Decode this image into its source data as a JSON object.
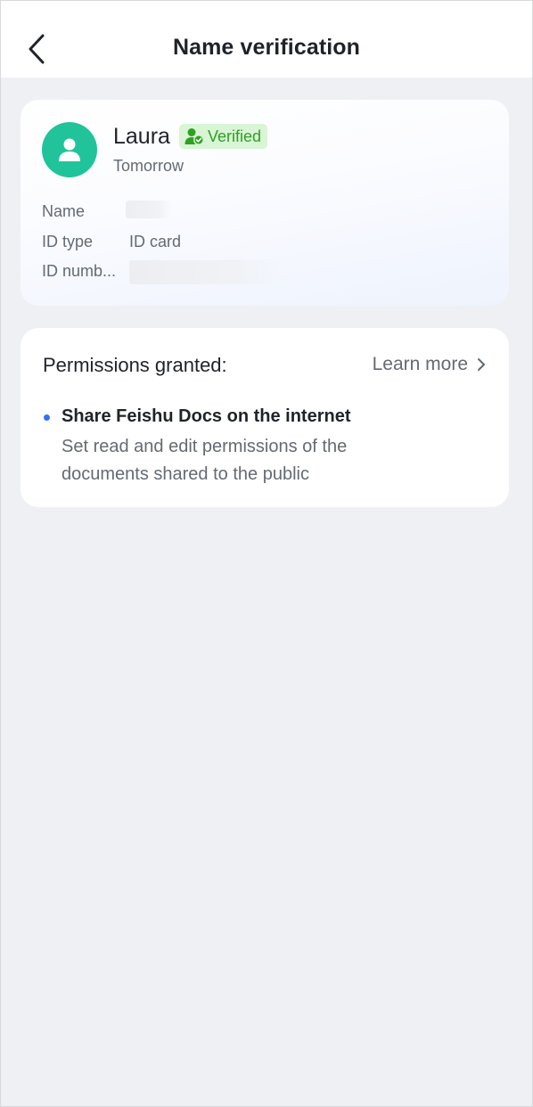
{
  "header": {
    "title": "Name verification"
  },
  "identity": {
    "name": "Laura",
    "badge": "Verified",
    "subtitle": "Tomorrow",
    "rows": [
      {
        "label": "Name",
        "value": ""
      },
      {
        "label": "ID type",
        "value": "ID card"
      },
      {
        "label": "ID numb...",
        "value": ""
      }
    ],
    "avatar_color": "#21c39a",
    "badge_color": "#2ea121"
  },
  "permissions": {
    "title": "Permissions granted:",
    "learn_more": "Learn more",
    "items": [
      {
        "title": "Share Feishu Docs on the internet",
        "description": "Set read and edit permissions of the documents shared to the public"
      }
    ],
    "bullet_color": "#3370ff"
  }
}
